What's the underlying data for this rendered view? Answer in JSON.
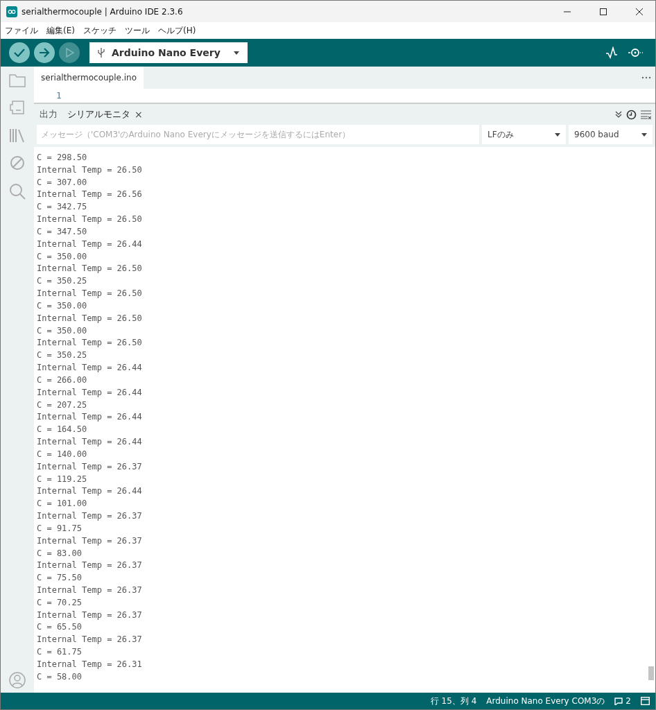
{
  "window": {
    "title": "serialthermocouple | Arduino IDE 2.3.6"
  },
  "menu": [
    "ファイル",
    "編集(E)",
    "スケッチ",
    "ツール",
    "ヘルプ(H)"
  ],
  "toolbar": {
    "board": "Arduino Nano Every"
  },
  "editor": {
    "tabs": [
      {
        "label": "serialthermocouple.ino",
        "selected": true
      }
    ],
    "line_numbers": [
      "1"
    ]
  },
  "panel": {
    "tabs": [
      {
        "label": "出力",
        "selected": false,
        "closable": false
      },
      {
        "label": "シリアルモニタ",
        "selected": true,
        "closable": true
      }
    ],
    "close_icon": "×",
    "message": {
      "placeholder": "メッセージ（'COM3'のArduino Nano Everyにメッセージを送信するにはEnter）"
    },
    "line_ending": "LFのみ",
    "baud": "9600 baud",
    "output": [
      "C = 298.50",
      "Internal Temp = 26.50",
      "C = 307.00",
      "Internal Temp = 26.56",
      "C = 342.75",
      "Internal Temp = 26.50",
      "C = 347.50",
      "Internal Temp = 26.44",
      "C = 350.00",
      "Internal Temp = 26.50",
      "C = 350.25",
      "Internal Temp = 26.50",
      "C = 350.00",
      "Internal Temp = 26.50",
      "C = 350.00",
      "Internal Temp = 26.50",
      "C = 350.25",
      "Internal Temp = 26.44",
      "C = 266.00",
      "Internal Temp = 26.44",
      "C = 207.25",
      "Internal Temp = 26.44",
      "C = 164.50",
      "Internal Temp = 26.44",
      "C = 140.00",
      "Internal Temp = 26.37",
      "C = 119.25",
      "Internal Temp = 26.44",
      "C = 101.00",
      "Internal Temp = 26.37",
      "C = 91.75",
      "Internal Temp = 26.37",
      "C = 83.00",
      "Internal Temp = 26.37",
      "C = 75.50",
      "Internal Temp = 26.37",
      "C = 70.25",
      "Internal Temp = 26.37",
      "C = 65.50",
      "Internal Temp = 26.37",
      "C = 61.75",
      "Internal Temp = 26.31",
      "C = 58.00"
    ]
  },
  "status_bar": {
    "position": "行 15、列 4",
    "board": "Arduino Nano Every COM3の",
    "notifications": "2"
  }
}
